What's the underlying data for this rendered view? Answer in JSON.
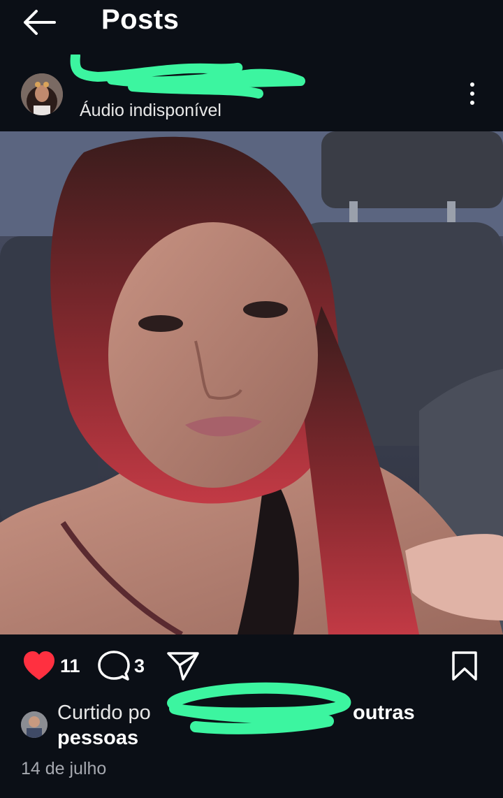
{
  "header": {
    "title": "Posts"
  },
  "post": {
    "audio_label": "Áudio indisponível",
    "likes": "11",
    "comments": "3",
    "liked_by_prefix": "Curtido po",
    "liked_by_suffix": "outras",
    "liked_by_line2": "pessoas",
    "date": "14 de julho"
  },
  "colors": {
    "background": "#0b0f16",
    "like": "#ff3040",
    "redaction": "#3cf5a0"
  },
  "icons": {
    "back": "arrow-left-icon",
    "more": "more-vertical-icon",
    "like": "heart-icon",
    "comment": "comment-icon",
    "share": "send-icon",
    "save": "bookmark-icon"
  }
}
